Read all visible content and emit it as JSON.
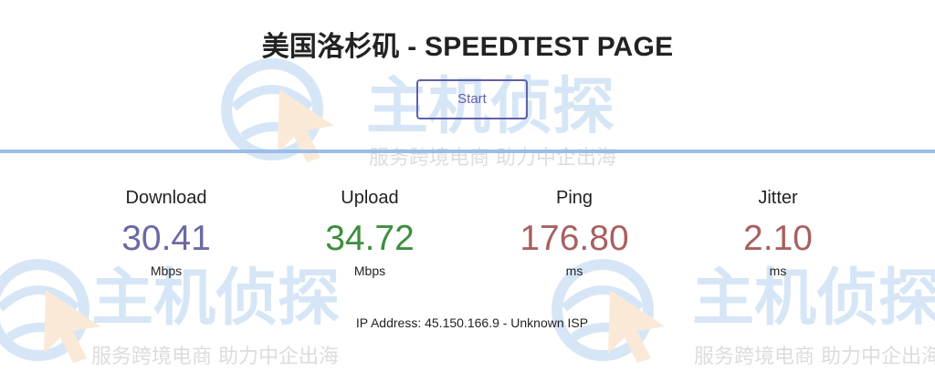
{
  "page": {
    "title": "美国洛杉矶 - SPEEDTEST PAGE"
  },
  "controls": {
    "start_label": "Start"
  },
  "results": {
    "download": {
      "label": "Download",
      "value": "30.41",
      "unit": "Mbps",
      "color": "#6a6aa4"
    },
    "upload": {
      "label": "Upload",
      "value": "34.72",
      "unit": "Mbps",
      "color": "#3e8e3e"
    },
    "ping": {
      "label": "Ping",
      "value": "176.80",
      "unit": "ms",
      "color": "#a86060"
    },
    "jitter": {
      "label": "Jitter",
      "value": "2.10",
      "unit": "ms",
      "color": "#a86060"
    }
  },
  "ip_info": {
    "text": "IP Address: 45.150.166.9 - Unknown ISP"
  },
  "watermark": {
    "brand": "主机侦探",
    "slogan": "服务跨境电商 助力中企出海",
    "icon": "globe-cursor-logo"
  },
  "colors": {
    "accent": "#6060aa",
    "progress_line": "#9bbde8",
    "watermark_blue": "#4a90d9",
    "watermark_orange": "#f0a050"
  }
}
